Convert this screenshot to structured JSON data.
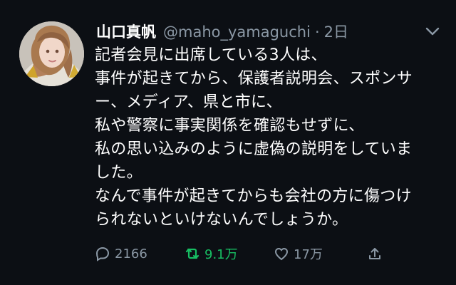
{
  "tweet": {
    "author": {
      "display_name": "山口真帆",
      "handle": "@maho_yamaguchi",
      "separator": "·",
      "time": "2日"
    },
    "text_lines": [
      "記者会見に出席している3人は、",
      "事件が起きてから、保護者説明会、スポンサ",
      "ー、メディア、県と市に、",
      "私や警察に事実関係を確認もせずに、",
      "私の思い込みのように虚偽の説明をしていま",
      "した。",
      "なんで事件が起きてからも会社の方に傷つけ",
      "られないといけないんでしょうか。"
    ],
    "stats": {
      "replies": "2166",
      "retweets": "9.1万",
      "likes": "17万"
    },
    "colors": {
      "background": "#0c0f14",
      "secondary_text": "#8b98a5",
      "retweet_active": "#17bf63"
    },
    "icons": [
      "reply-icon",
      "retweet-icon",
      "like-icon",
      "share-icon",
      "chevron-down-icon"
    ]
  }
}
